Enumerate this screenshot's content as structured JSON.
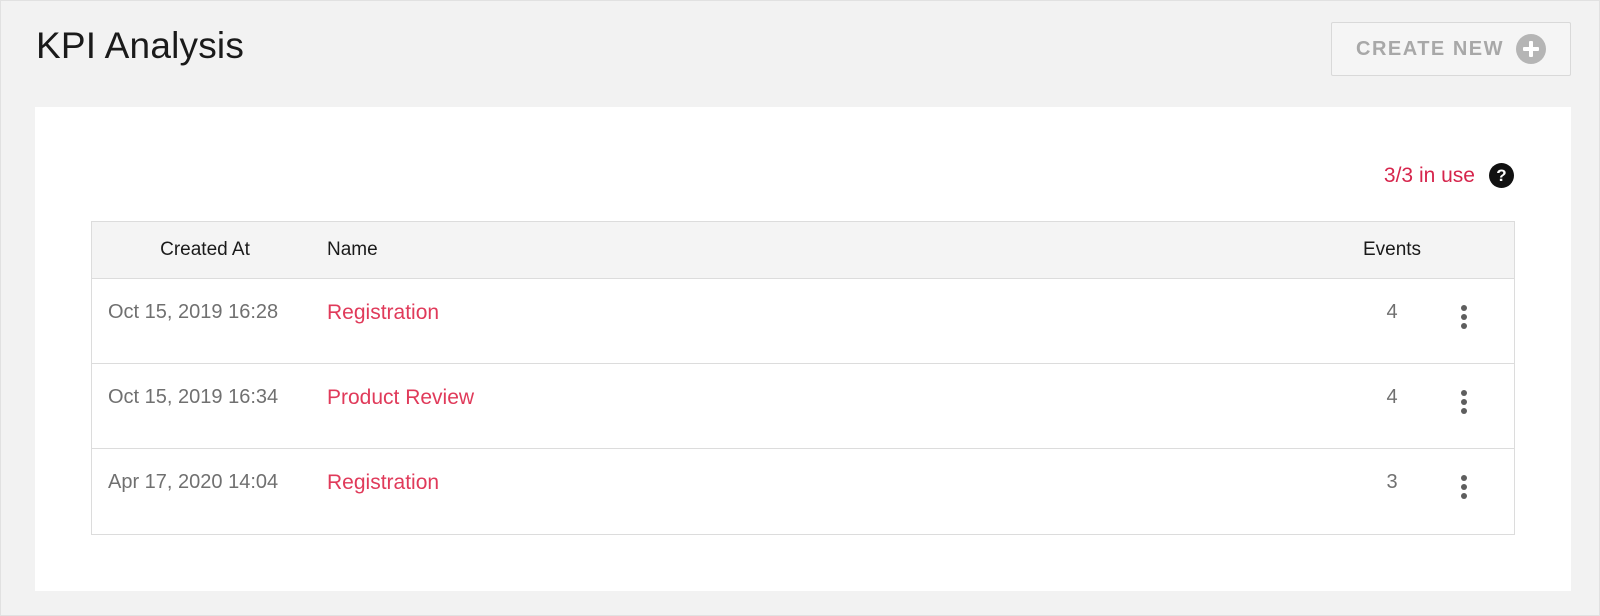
{
  "header": {
    "title": "KPI Analysis",
    "create_label": "CREATE NEW",
    "create_icon": "plus-circle-icon"
  },
  "usage": {
    "text": "3/3 in use",
    "help_glyph": "?",
    "color": "#d6254c"
  },
  "table": {
    "columns": {
      "created_at": "Created At",
      "name": "Name",
      "events": "Events"
    },
    "rows": [
      {
        "created_at": "Oct 15, 2019 16:28",
        "name": "Registration",
        "events": "4"
      },
      {
        "created_at": "Oct 15, 2019 16:34",
        "name": "Product Review",
        "events": "4"
      },
      {
        "created_at": "Apr 17, 2020 14:04",
        "name": "Registration",
        "events": "3"
      }
    ],
    "row_menu_icon": "kebab-menu-icon",
    "link_color": "#e03a5a"
  }
}
